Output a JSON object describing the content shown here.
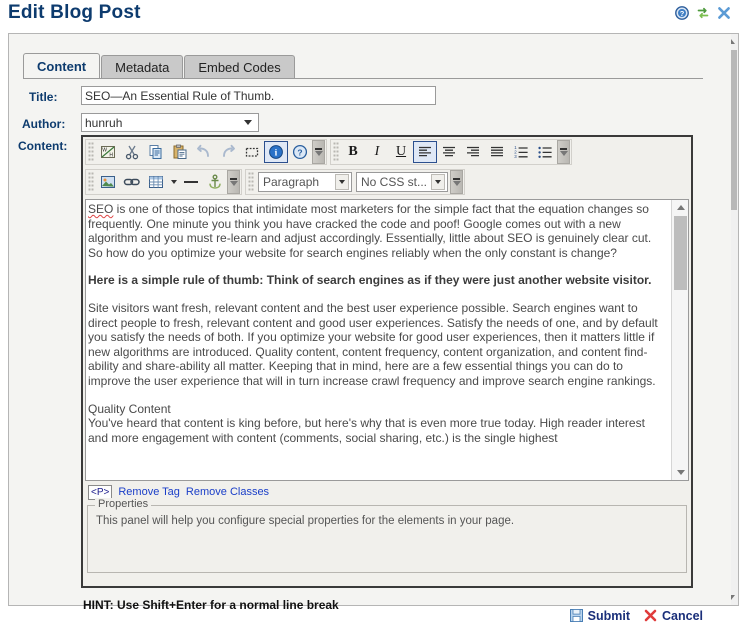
{
  "page": {
    "title": "Edit Blog Post",
    "title_color": "#0d3b6e"
  },
  "header_icons": [
    {
      "name": "help-icon",
      "label": "Help"
    },
    {
      "name": "refresh-icon",
      "label": "Refresh"
    },
    {
      "name": "close-icon",
      "label": "Close"
    }
  ],
  "tabs": [
    {
      "label": "Content",
      "active": true
    },
    {
      "label": "Metadata",
      "active": false
    },
    {
      "label": "Embed Codes",
      "active": false
    }
  ],
  "form": {
    "title_label": "Title:",
    "title_value": "SEO—An Essential Rule of Thumb.",
    "title_placeholder": "",
    "author_label": "Author:",
    "author_value": "hunruh",
    "content_label": "Content:"
  },
  "toolbar": {
    "row1": [
      {
        "name": "toggle-wysiwyg-html-icon",
        "label": "W/H"
      },
      {
        "name": "cut-icon",
        "label": "Cut"
      },
      {
        "name": "copy-icon",
        "label": "Copy"
      },
      {
        "name": "paste-icon",
        "label": "Paste"
      },
      {
        "name": "undo-icon",
        "label": "Undo"
      },
      {
        "name": "redo-icon",
        "label": "Redo"
      },
      {
        "name": "select-all-icon",
        "label": "Select All"
      },
      {
        "name": "info-icon",
        "label": "Info"
      },
      {
        "name": "help-icon",
        "label": "Help"
      }
    ],
    "row1b": [
      {
        "name": "bold-icon",
        "label": "B"
      },
      {
        "name": "italic-icon",
        "label": "I"
      },
      {
        "name": "underline-icon",
        "label": "U"
      },
      {
        "name": "align-left-icon",
        "label": "Align Left"
      },
      {
        "name": "align-center-icon",
        "label": "Align Center"
      },
      {
        "name": "align-right-icon",
        "label": "Align Right"
      },
      {
        "name": "align-justify-icon",
        "label": "Justify"
      },
      {
        "name": "ordered-list-icon",
        "label": "Numbered List"
      },
      {
        "name": "unordered-list-icon",
        "label": "Bulleted List"
      }
    ],
    "row2": [
      {
        "name": "insert-image-icon",
        "label": "Insert Image"
      },
      {
        "name": "insert-link-icon",
        "label": "Insert Link"
      },
      {
        "name": "insert-table-icon",
        "label": "Insert Table"
      },
      {
        "name": "horizontal-rule-icon",
        "label": "Horizontal Rule"
      },
      {
        "name": "anchor-icon",
        "label": "Anchor"
      }
    ],
    "paragraph_select": "Paragraph",
    "css_select": "No CSS st..."
  },
  "content": {
    "paragraphs": [
      {
        "style": "normal",
        "spell_word": "SEO",
        "text": " is one of those topics that intimidate most marketers for the simple fact that the equation changes so frequently. One minute you think you have cracked the code and poof! Google comes out with a new algorithm and you must re-learn and adjust accordingly. Essentially, little about SEO is genuinely clear cut. So how do you optimize your website for search engines reliably when the only constant is change?"
      },
      {
        "style": "bold",
        "text": "Here is a simple rule of thumb: Think of search engines as if they were just another website visitor."
      },
      {
        "style": "normal",
        "text": "Site visitors want fresh, relevant content and the best user experience possible. Search engines want to direct people to fresh, relevant content and good user experiences. Satisfy the needs of one, and by default you satisfy the needs of both. If you optimize your website for good user experiences, then it matters little if new algorithms are introduced. Quality content, content frequency, content organization, and content find-ability and share-ability all matter. Keeping that in mind, here are a few essential things you can do to improve the user experience that will in turn increase crawl frequency and improve search engine rankings."
      },
      {
        "style": "heading",
        "text": "Quality Content"
      },
      {
        "style": "normal",
        "text": "You've heard that content is king before, but here's why that is even more true today. High reader interest and more engagement with content (comments, social sharing, etc.) is the single highest"
      }
    ]
  },
  "tag_bar": {
    "tag": "<P>",
    "links": [
      {
        "label": "Remove Tag"
      },
      {
        "label": "Remove Classes"
      }
    ]
  },
  "properties": {
    "legend": "Properties",
    "text": "This panel will help you configure special properties for the elements in your page."
  },
  "hint": "HINT: Use Shift+Enter for a normal line break",
  "footer": {
    "submit_label": "Submit",
    "cancel_label": "Cancel"
  }
}
